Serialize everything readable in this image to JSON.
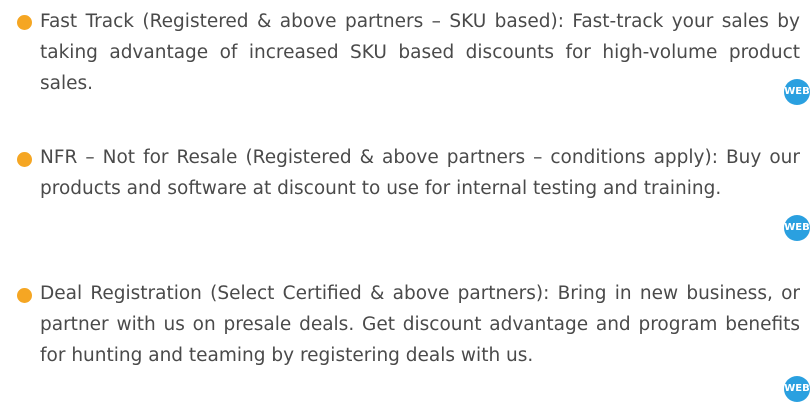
{
  "items": [
    {
      "title": "Fast Track",
      "body": " (Registered & above partners – SKU based): Fast-track your sales by taking advantage of increased SKU based discounts for high-volume product sales.",
      "icon": "web-icon",
      "icon_label": "WEB"
    },
    {
      "title": "NFR – Not for Resale",
      "body": " (Registered & above partners – conditions apply): Buy our products and software at discount to use for internal testing and training.",
      "icon": "web-icon",
      "icon_label": "WEB"
    },
    {
      "title": "Deal Registration",
      "body": " (Select Certified & above partners): Bring in new business, or partner with us on presale deals. Get discount advantage and program benefits for hunting and teaming by registering deals with us.",
      "icon": "web-icon",
      "icon_label": "WEB"
    }
  ],
  "colors": {
    "bullet": "#f5a623",
    "icon_bg": "#2aa0e0",
    "text": "#4a4a4a"
  }
}
